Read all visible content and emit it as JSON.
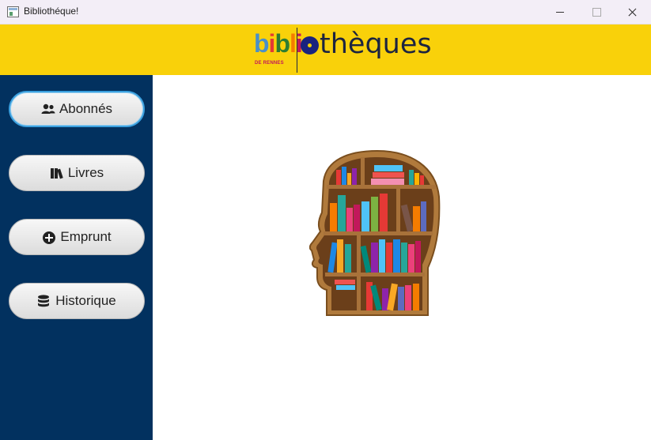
{
  "window": {
    "title": "Bibliothéque!"
  },
  "header": {
    "logo_biblio_letters": [
      "b",
      "i",
      "b",
      "l",
      "i"
    ],
    "logo_biblio_colors": [
      "#4a90c8",
      "#e53935",
      "#2e7d32",
      "#f57c00",
      "#c2185b"
    ],
    "logo_subtitle": "DE RENNES",
    "logo_theques_rest": "thèques",
    "background_color": "#f9d10a"
  },
  "sidebar": {
    "background_color": "#02315f",
    "items": [
      {
        "label": "Abonnés",
        "icon": "users-icon",
        "focused": true
      },
      {
        "label": "Livres",
        "icon": "books-icon",
        "focused": false
      },
      {
        "label": "Emprunt",
        "icon": "plus-circle-icon",
        "focused": false
      },
      {
        "label": "Historique",
        "icon": "database-icon",
        "focused": false
      }
    ]
  },
  "main": {
    "illustration": "head-bookshelf-illustration"
  }
}
